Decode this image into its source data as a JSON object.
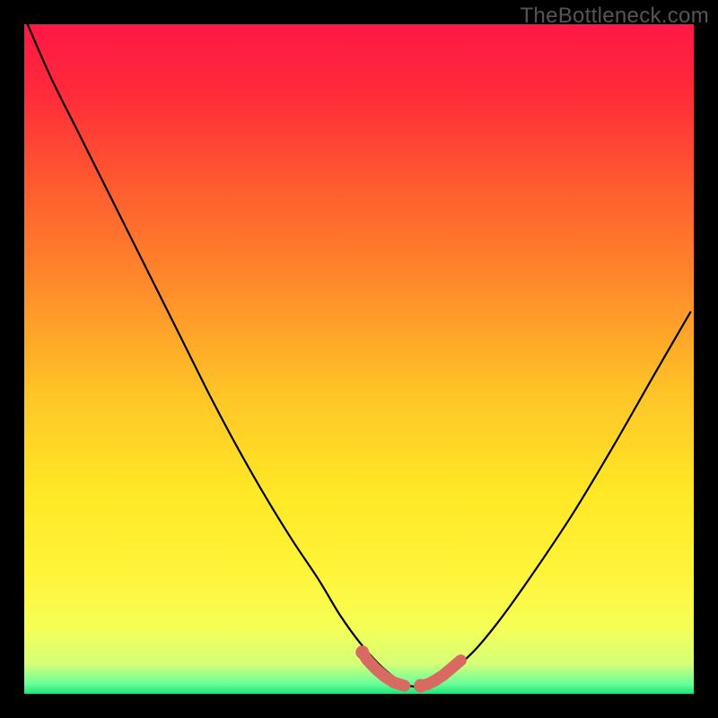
{
  "watermark": "TheBottleneck.com",
  "colors": {
    "frame": "#000000",
    "gradient_stops": [
      {
        "offset": 0.0,
        "color": "#ff1846"
      },
      {
        "offset": 0.1,
        "color": "#ff2a3a"
      },
      {
        "offset": 0.25,
        "color": "#ff5e2f"
      },
      {
        "offset": 0.4,
        "color": "#ff8e2a"
      },
      {
        "offset": 0.55,
        "color": "#ffc427"
      },
      {
        "offset": 0.7,
        "color": "#ffe826"
      },
      {
        "offset": 0.82,
        "color": "#fff43a"
      },
      {
        "offset": 0.9,
        "color": "#f6ff55"
      },
      {
        "offset": 0.955,
        "color": "#d6ff78"
      },
      {
        "offset": 0.985,
        "color": "#6aff9a"
      },
      {
        "offset": 1.0,
        "color": "#20e27a"
      }
    ],
    "curve_stroke": "#000000",
    "marker_stroke": "#d86a63",
    "marker_fill": "#d86a63"
  },
  "chart_data": {
    "type": "line",
    "title": "",
    "xlabel": "",
    "ylabel": "",
    "xlim": [
      0,
      100
    ],
    "ylim": [
      0,
      100
    ],
    "grid": false,
    "series": [
      {
        "name": "bottleneck-curve",
        "x": [
          0.5,
          4,
          8,
          12,
          16,
          20,
          24,
          28,
          32,
          36,
          40,
          44,
          47,
          50,
          53,
          55.5,
          57.5,
          60,
          63,
          67,
          71,
          76,
          82,
          88,
          94,
          99.5
        ],
        "y": [
          100,
          92,
          84,
          76,
          68,
          60,
          52,
          44,
          36.5,
          29.5,
          23,
          17,
          12,
          7.8,
          4.4,
          2.3,
          1.2,
          1.2,
          2.8,
          6.2,
          11,
          18,
          27,
          37,
          47.5,
          57
        ]
      }
    ],
    "highlight_segments": [
      {
        "name": "left-marker",
        "x": [
          50.5,
          51.2,
          52.4,
          53.8,
          55.2,
          56.8
        ],
        "y": [
          6.2,
          5.1,
          3.8,
          2.6,
          1.7,
          1.2
        ]
      },
      {
        "name": "right-marker",
        "x": [
          59.2,
          60.2,
          61.4,
          62.6,
          63.8,
          65.2
        ],
        "y": [
          1.2,
          1.4,
          2.0,
          2.8,
          3.8,
          5.0
        ]
      }
    ]
  }
}
